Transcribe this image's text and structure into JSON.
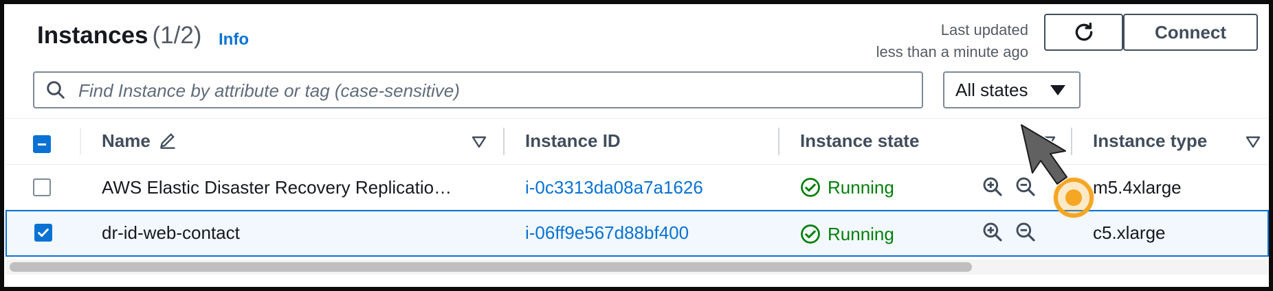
{
  "header": {
    "title": "Instances",
    "count": "(1/2)",
    "info_link": "Info",
    "last_updated_line1": "Last updated",
    "last_updated_line2": "less than a minute ago",
    "connect_label": "Connect"
  },
  "search": {
    "placeholder": "Find Instance by attribute or tag (case-sensitive)",
    "value": ""
  },
  "state_filter": {
    "selected": "All states"
  },
  "table": {
    "columns": [
      "Name",
      "Instance ID",
      "Instance state",
      "Instance type"
    ],
    "rows": [
      {
        "selected": false,
        "name": "AWS Elastic Disaster Recovery Replicatio…",
        "instance_id": "i-0c3313da08a7a1626",
        "state": "Running",
        "type": "m5.4xlarge"
      },
      {
        "selected": true,
        "name": "dr-id-web-contact",
        "instance_id": "i-06ff9e567d88bf400",
        "state": "Running",
        "type": "c5.xlarge"
      }
    ]
  },
  "icons": {
    "refresh": "refresh-icon",
    "search": "search-icon",
    "edit": "pencil-icon",
    "zoom_in": "zoom-in-icon",
    "zoom_out": "zoom-out-icon",
    "status_ok": "check-circle-icon",
    "cursor": "mouse-pointer-icon"
  },
  "colors": {
    "link": "#0972d3",
    "running": "#037f0c",
    "selected_row_bg": "#f2f8fd",
    "cursor_highlight": "#f5a623"
  }
}
